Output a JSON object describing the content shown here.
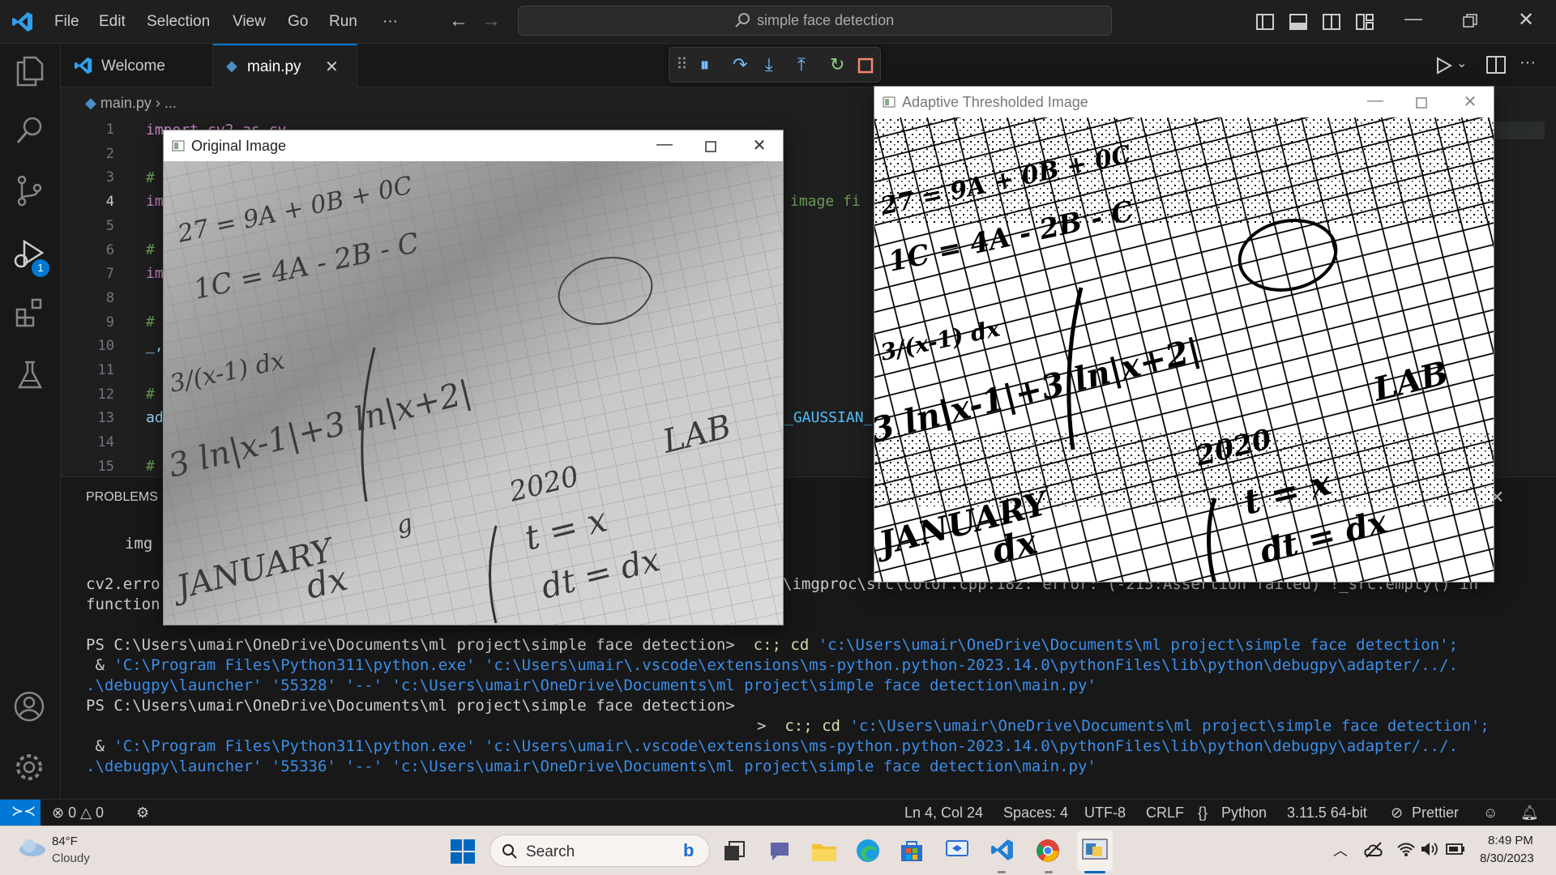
{
  "titlebar": {
    "menus": [
      "File",
      "Edit",
      "Selection",
      "View",
      "Go",
      "Run",
      "···"
    ],
    "search_placeholder": "simple face detection"
  },
  "tabs": [
    {
      "label": "Welcome",
      "active": false
    },
    {
      "label": "main.py",
      "active": true
    }
  ],
  "breadcrumb": {
    "file": "main.py",
    "more": "..."
  },
  "editor": {
    "line_numbers": [
      "1",
      "2",
      "3",
      "4",
      "5",
      "6",
      "7",
      "8",
      "9",
      "10",
      "11",
      "12",
      "13",
      "14",
      "15"
    ],
    "fragments": {
      "line1": "import cv2 as cv",
      "line3": "#",
      "line4": "im",
      "line4_tail": "image fi",
      "line6": "#",
      "line7": "im",
      "line9": "#",
      "line10": "_,",
      "line12": "#",
      "line13": "ad",
      "line13_tail": "_GAUSSIAN_",
      "line15": "#"
    }
  },
  "debug_toolbar": [
    "pause",
    "step-over",
    "step-into",
    "step-out",
    "restart",
    "stop"
  ],
  "panel": {
    "tab": "PROBLEMS",
    "lines": {
      "img": "img",
      "err1": "cv2.erro",
      "err1_tail": "\\imgproc\\src\\color.cpp:182: error: (-215:Assertion failed) !_src.empty() in",
      "err2": "function",
      "ps1_prompt": "PS C:\\Users\\umair\\OneDrive\\Documents\\ml project\\simple face detection>",
      "ps1_cmd_a": "c:; cd",
      "ps1_cmd_b": "'c:\\Users\\umair\\OneDrive\\Documents\\ml project\\simple face detection';",
      "ps1_l2_amp": " &",
      "ps1_l2": "'C:\\Program Files\\Python311\\python.exe' 'c:\\Users\\umair\\.vscode\\extensions\\ms-python.python-2023.14.0\\pythonFiles\\lib\\python\\debugpy\\adapter/../.",
      "ps1_l3": ".\\debugpy\\launcher' '55328' '--' 'c:\\Users\\umair\\OneDrive\\Documents\\ml project\\simple face detection\\main.py'",
      "ps2_prompt": "PS C:\\Users\\umair\\OneDrive\\Documents\\ml project\\simple face detection>",
      "ps2_arrow": ">",
      "ps2_cmd_a": "c:; cd",
      "ps2_cmd_b": "'c:\\Users\\umair\\OneDrive\\Documents\\ml project\\simple face detection';",
      "ps2_l2_amp": " &",
      "ps2_l2": "'C:\\Program Files\\Python311\\python.exe' 'c:\\Users\\umair\\.vscode\\extensions\\ms-python.python-2023.14.0\\pythonFiles\\lib\\python\\debugpy\\adapter/../.",
      "ps2_l3": ".\\debugpy\\launcher' '55336' '--' 'c:\\Users\\umair\\OneDrive\\Documents\\ml project\\simple face detection\\main.py'"
    }
  },
  "windows": {
    "original": {
      "title": "Original Image"
    },
    "adaptive": {
      "title": "Adaptive Thresholded Image"
    }
  },
  "image_text": {
    "jan": "JANUARY",
    "lab": "LAB",
    "year": "2020",
    "ln": "3 ln|x-1|+3 ln|x+2|",
    "frac": "3/(x-1) dx",
    "t": "t = x",
    "dt": "dt = dx",
    "c": "1C = 4A - 2B - C",
    "a": "27 = 9A + 0B + 0C",
    "dx": "dx",
    "g": "g"
  },
  "activity_badge": "1",
  "statusbar": {
    "errors": "0",
    "warnings": "0",
    "position": "Ln 4, Col 24",
    "spaces": "Spaces: 4",
    "encoding": "UTF-8",
    "eol": "CRLF",
    "language": "Python",
    "interpreter": "3.11.5 64-bit",
    "formatter": "Prettier"
  },
  "taskbar": {
    "weather_temp": "84°F",
    "weather_desc": "Cloudy",
    "search": "Search",
    "time": "8:49 PM",
    "date": "8/30/2023"
  },
  "colors": {
    "accent": "#0078d4",
    "status_remote": "#0078d4",
    "keyword": "#c586c0"
  }
}
